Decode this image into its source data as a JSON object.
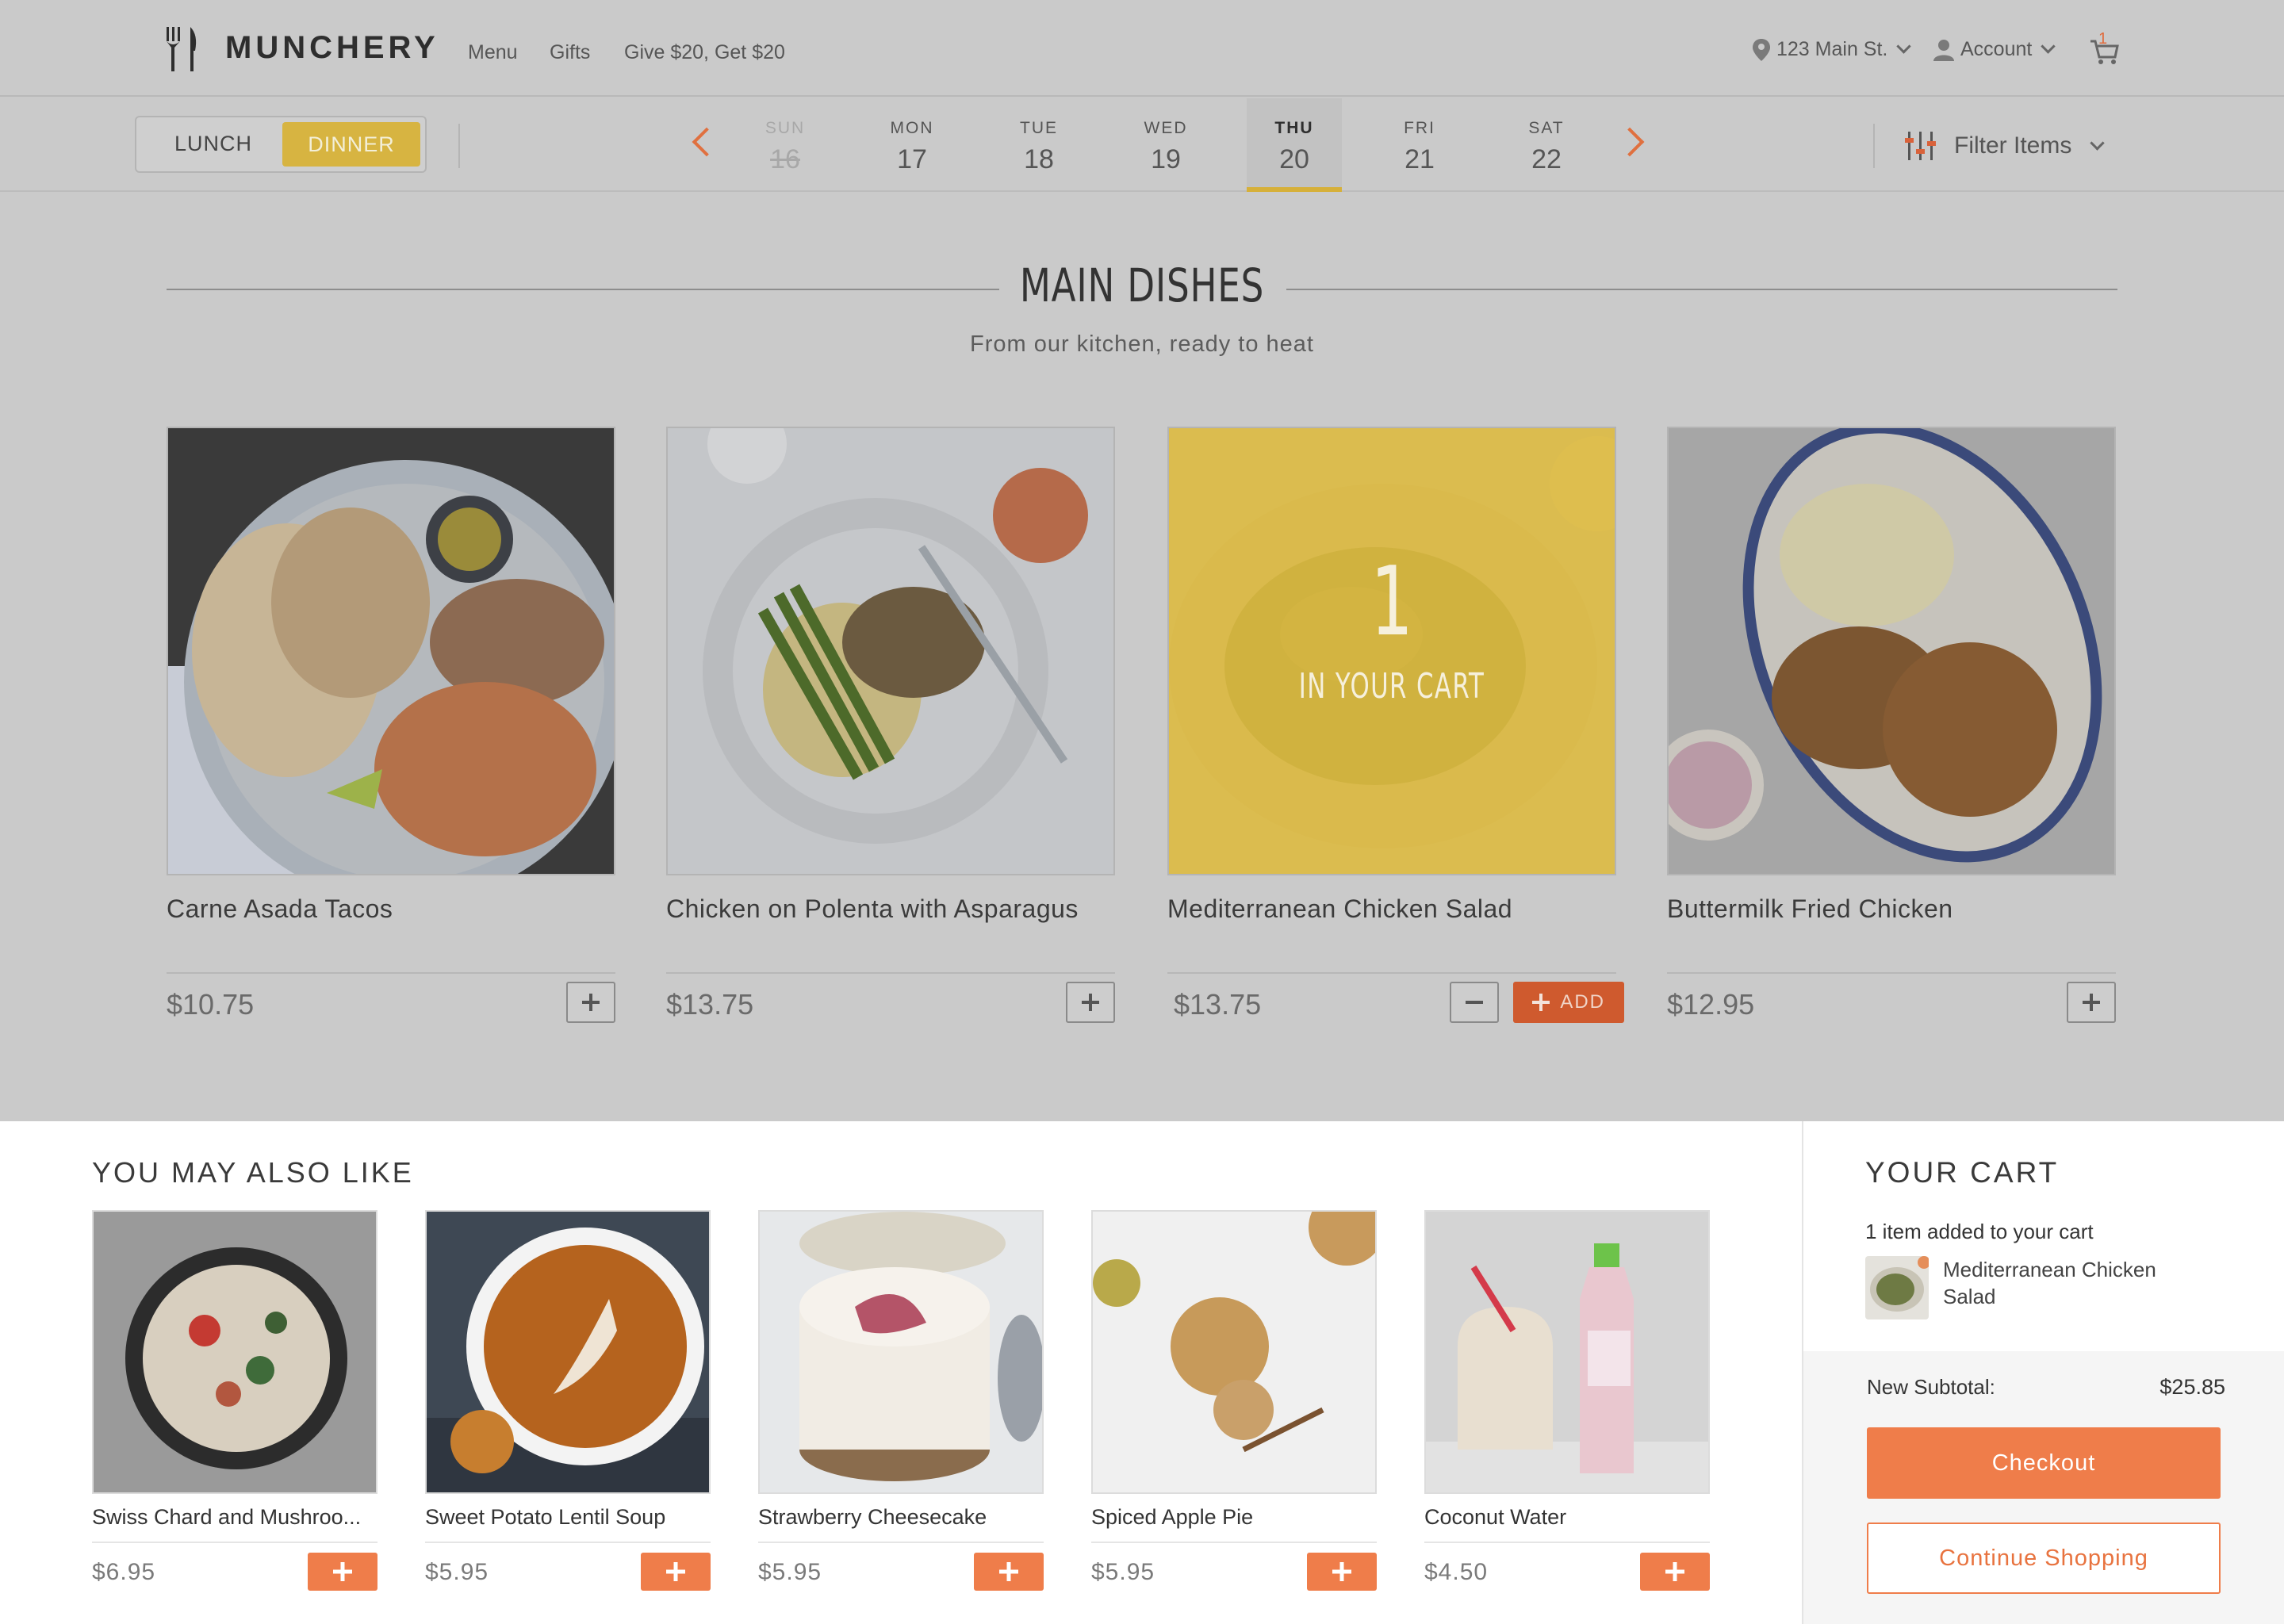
{
  "brand": {
    "name": "MUNCHERY"
  },
  "nav": {
    "links": [
      "Menu",
      "Gifts",
      "Give $20, Get $20"
    ],
    "address": "123 Main St.",
    "account": "Account",
    "cart_count": "1"
  },
  "meal_toggle": {
    "lunch": "LUNCH",
    "dinner": "DINNER",
    "selected": "DINNER"
  },
  "days": [
    {
      "name": "SUN",
      "date": "16",
      "state": "past"
    },
    {
      "name": "MON",
      "date": "17",
      "state": "normal"
    },
    {
      "name": "TUE",
      "date": "18",
      "state": "normal"
    },
    {
      "name": "WED",
      "date": "19",
      "state": "normal"
    },
    {
      "name": "THU",
      "date": "20",
      "state": "active"
    },
    {
      "name": "FRI",
      "date": "21",
      "state": "normal"
    },
    {
      "name": "SAT",
      "date": "22",
      "state": "normal"
    }
  ],
  "filter": {
    "label": "Filter Items"
  },
  "section": {
    "title": "MAIN DISHES",
    "subtitle": "From our kitchen, ready to heat"
  },
  "main_dishes": [
    {
      "name": "Carne Asada Tacos",
      "price": "$10.75",
      "in_cart": false
    },
    {
      "name": "Chicken on Polenta with Asparagus",
      "price": "$13.75",
      "in_cart": false
    },
    {
      "name": "Mediterranean Chicken Salad",
      "price": "$13.75",
      "in_cart": true,
      "cart_qty": "1",
      "cart_text": "IN YOUR CART",
      "add_label": "ADD"
    },
    {
      "name": "Buttermilk Fried Chicken",
      "price": "$12.95",
      "in_cart": false
    }
  ],
  "recommendations": {
    "title": "YOU MAY ALSO LIKE",
    "items": [
      {
        "name": "Swiss Chard and Mushroo...",
        "price": "$6.95"
      },
      {
        "name": "Sweet Potato Lentil Soup",
        "price": "$5.95"
      },
      {
        "name": "Strawberry Cheesecake",
        "price": "$5.95"
      },
      {
        "name": "Spiced Apple Pie",
        "price": "$5.95"
      },
      {
        "name": "Coconut Water",
        "price": "$4.50"
      }
    ]
  },
  "cart": {
    "title": "YOUR CART",
    "added_text": "1 item added to your cart",
    "item_name": "Mediterranean Chicken Salad",
    "subtotal_label": "New Subtotal:",
    "subtotal_value": "$25.85",
    "checkout_label": "Checkout",
    "continue_label": "Continue Shopping"
  },
  "colors": {
    "accent_orange": "#ef7d4a",
    "accent_yellow": "#d6b03a",
    "overlay_gray": "#cacaca"
  }
}
